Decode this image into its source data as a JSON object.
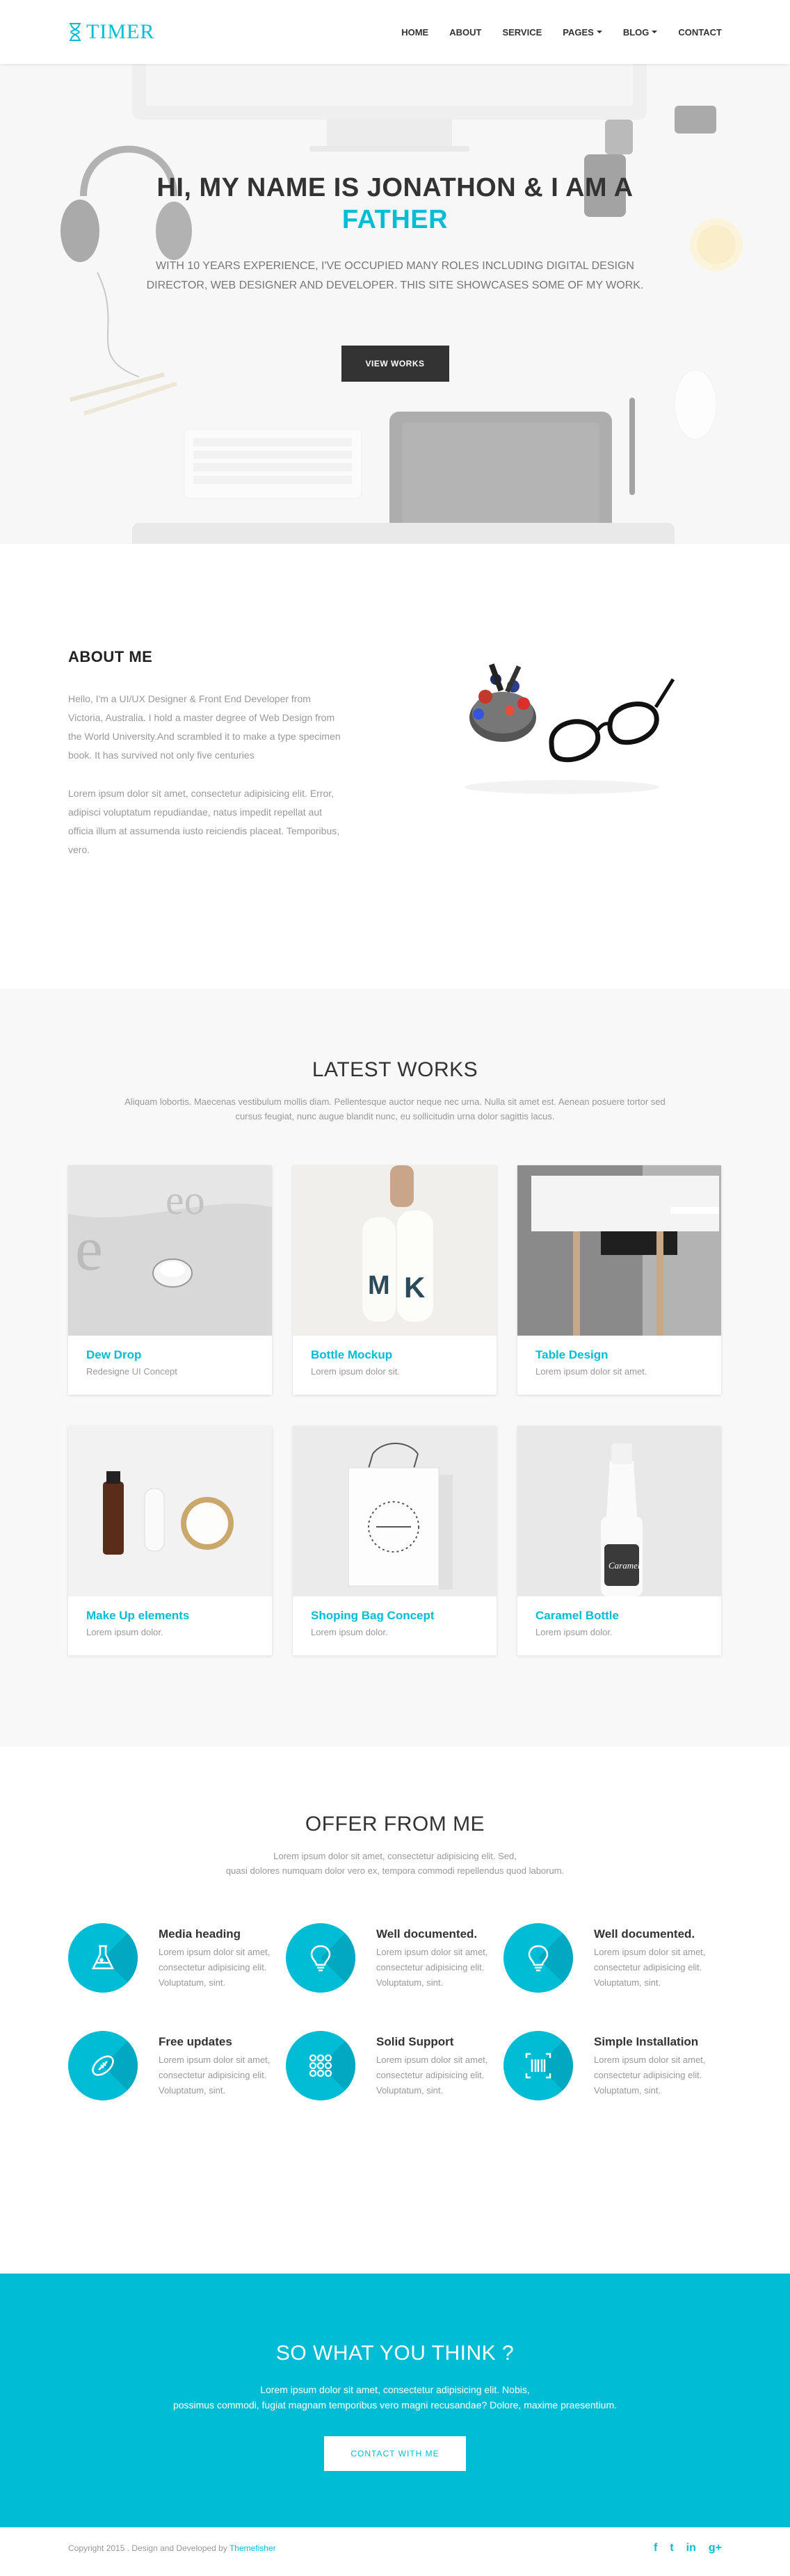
{
  "brand": {
    "name": "TIMER",
    "accent": "#00bcd4"
  },
  "nav": [
    {
      "label": "HOME",
      "dropdown": false
    },
    {
      "label": "ABOUT",
      "dropdown": false
    },
    {
      "label": "SERVICE",
      "dropdown": false
    },
    {
      "label": "PAGES",
      "dropdown": true
    },
    {
      "label": "BLOG",
      "dropdown": true
    },
    {
      "label": "CONTACT",
      "dropdown": false
    }
  ],
  "hero": {
    "title": "HI, MY NAME IS JONATHON & I AM A",
    "accent": "FATHER",
    "text": "WITH 10 YEARS EXPERIENCE, I'VE OCCUPIED MANY ROLES INCLUDING DIGITAL DESIGN DIRECTOR, WEB DESIGNER AND DEVELOPER. THIS SITE SHOWCASES SOME OF MY WORK.",
    "button": "VIEW WORKS"
  },
  "about": {
    "title": "ABOUT ME",
    "p1": "Hello, I'm a UI/UX Designer & Front End Developer from Victoria, Australia. I hold a master degree of Web Design from the World University.And scrambled it to make a type specimen book. It has survived not only five centuries",
    "p2": "Lorem ipsum dolor sit amet, consectetur adipisicing elit. Error, adipisci voluptatum repudiandae, natus impedit repellat aut officia illum at assumenda iusto reiciendis placeat. Temporibus, vero."
  },
  "works": {
    "title": "LATEST WORKS",
    "subtitle": "Aliquam lobortis. Maecenas vestibulum mollis diam. Pellentesque auctor neque nec urna. Nulla sit amet est. Aenean posuere tortor sed cursus feugiat, nunc augue blandit nunc, eu sollicitudin urna dolor sagittis lacus.",
    "items": [
      {
        "title": "Dew Drop",
        "desc": "Redesigne UI Concept"
      },
      {
        "title": "Bottle Mockup",
        "desc": "Lorem ipsum dolor sit."
      },
      {
        "title": "Table Design",
        "desc": "Lorem ipsum dolor sit amet."
      },
      {
        "title": "Make Up elements",
        "desc": "Lorem ipsum dolor."
      },
      {
        "title": "Shoping Bag Concept",
        "desc": "Lorem ipsum dolor."
      },
      {
        "title": "Caramel Bottle",
        "desc": "Lorem ipsum dolor."
      }
    ]
  },
  "offers": {
    "title": "OFFER FROM ME",
    "subtitle_line1": "Lorem ipsum dolor sit amet, consectetur adipisicing elit. Sed,",
    "subtitle_line2": "quasi dolores numquam dolor vero ex, tempora commodi repellendus quod laborum.",
    "items": [
      {
        "icon": "flask-icon",
        "title": "Media heading",
        "desc": "Lorem ipsum dolor sit amet, consectetur adipisicing elit. Voluptatum, sint."
      },
      {
        "icon": "lightbulb-icon",
        "title": "Well documented.",
        "desc": "Lorem ipsum dolor sit amet, consectetur adipisicing elit. Voluptatum, sint."
      },
      {
        "icon": "lightbulb-icon",
        "title": "Well documented.",
        "desc": "Lorem ipsum dolor sit amet, consectetur adipisicing elit. Voluptatum, sint."
      },
      {
        "icon": "football-icon",
        "title": "Free updates",
        "desc": "Lorem ipsum dolor sit amet, consectetur adipisicing elit. Voluptatum, sint."
      },
      {
        "icon": "grid-dots-icon",
        "title": "Solid Support",
        "desc": "Lorem ipsum dolor sit amet, consectetur adipisicing elit. Voluptatum, sint."
      },
      {
        "icon": "barcode-icon",
        "title": "Simple Installation",
        "desc": "Lorem ipsum dolor sit amet, consectetur adipisicing elit. Voluptatum, sint."
      }
    ]
  },
  "cta": {
    "title": "SO WHAT YOU THINK ?",
    "line1": "Lorem ipsum dolor sit amet, consectetur adipisicing elit. Nobis,",
    "line2": "possimus commodi, fugiat magnam temporibus vero magni recusandae? Dolore, maxime praesentium.",
    "button": "CONTACT WITH ME"
  },
  "footer": {
    "copyright": "Copyright 2015 . Design and Developed by",
    "author": "Themefisher",
    "social": [
      {
        "icon": "facebook-icon",
        "glyph": "f"
      },
      {
        "icon": "twitter-icon",
        "glyph": "t"
      },
      {
        "icon": "linkedin-icon",
        "glyph": "in"
      },
      {
        "icon": "google-plus-icon",
        "glyph": "g+"
      }
    ]
  }
}
